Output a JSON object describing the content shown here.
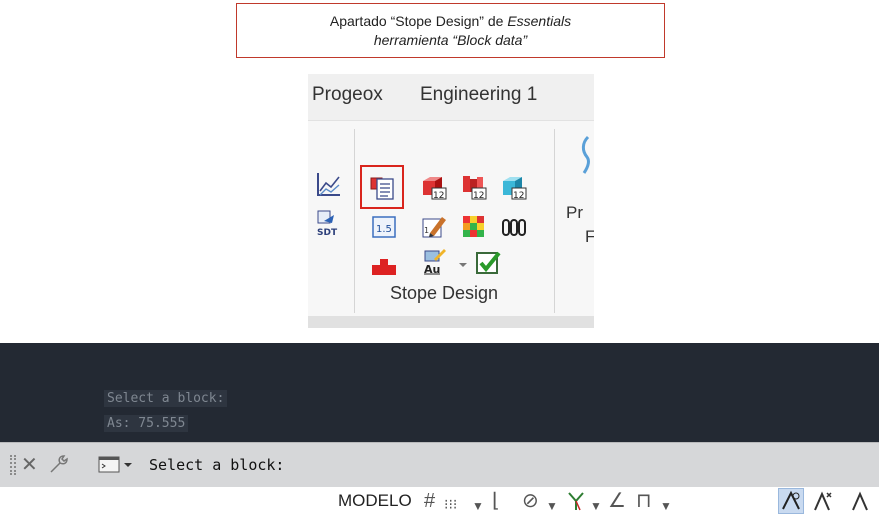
{
  "caption": {
    "prefix": "Apartado “Stope Design” de ",
    "essentials": "Essentials",
    "line2": "herramienta “Block data”"
  },
  "ribbon": {
    "tabs": [
      "Progeox",
      "Engineering 1"
    ],
    "group_label": "Stope Design",
    "cut_labels": [
      "Pr",
      "F"
    ],
    "icons": {
      "col0": [
        "chart-icon",
        "sdt-export-icon"
      ],
      "row1": [
        "block-data-icon",
        "block-12-icon",
        "block-multi-12-icon",
        "block-cyan-12-icon"
      ],
      "row2": [
        "value-1-5-icon",
        "edit-block-icon",
        "color-grid-icon",
        "drillholes-icon"
      ],
      "row3": [
        "red-block-icon",
        "au-grade-icon",
        "dropdown-arrow-icon",
        "checkbox-icon"
      ],
      "highlighted": "block-data-icon"
    }
  },
  "console": {
    "history": [
      "Select a block:",
      "As: 75.555"
    ],
    "command_text": "Select a block:"
  },
  "statusbar": {
    "model_label": "MODELO"
  },
  "colors": {
    "highlight": "#d9251d",
    "console_bg": "#232933",
    "ribbon_bg": "#f0f0f0"
  }
}
